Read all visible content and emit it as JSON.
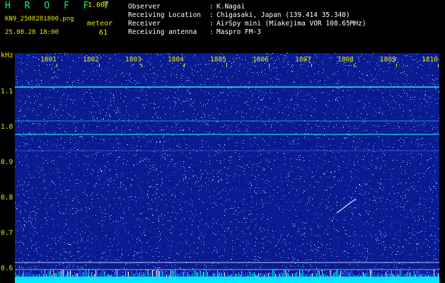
{
  "header": {
    "app_title": "H R O F F T",
    "version": "1.00f",
    "filename": "KN9_2508281800.png",
    "counter_label": "meteor",
    "datetime": "25.08.28 18:00",
    "counter_value": "61"
  },
  "info": [
    {
      "label": "Observer",
      "value": "K.Nagai"
    },
    {
      "label": "Receiving Location",
      "value": "Chigasaki, Japan (139.414 35.340)"
    },
    {
      "label": "Receiver",
      "value": "AirSpy mini (Miakejima VOR 108.65MHz)"
    },
    {
      "label": "Receiving antenna",
      "value": "Maspro FM-3"
    }
  ],
  "axis": {
    "y_unit": "kHz",
    "y_ticks": [
      "1.1",
      "1.0",
      "0.9",
      "0.8",
      "0.7",
      "0.6"
    ],
    "x_ticks": [
      "1801",
      "1802",
      "1803",
      "1804",
      "1805",
      "1806",
      "1807",
      "1808",
      "1809",
      "1810"
    ]
  },
  "colors": {
    "background": "#000000",
    "label": "#e8e800",
    "title": "#00ff66",
    "spectrogram_bg": "#0a1a90",
    "signal": "#33ffee"
  }
}
